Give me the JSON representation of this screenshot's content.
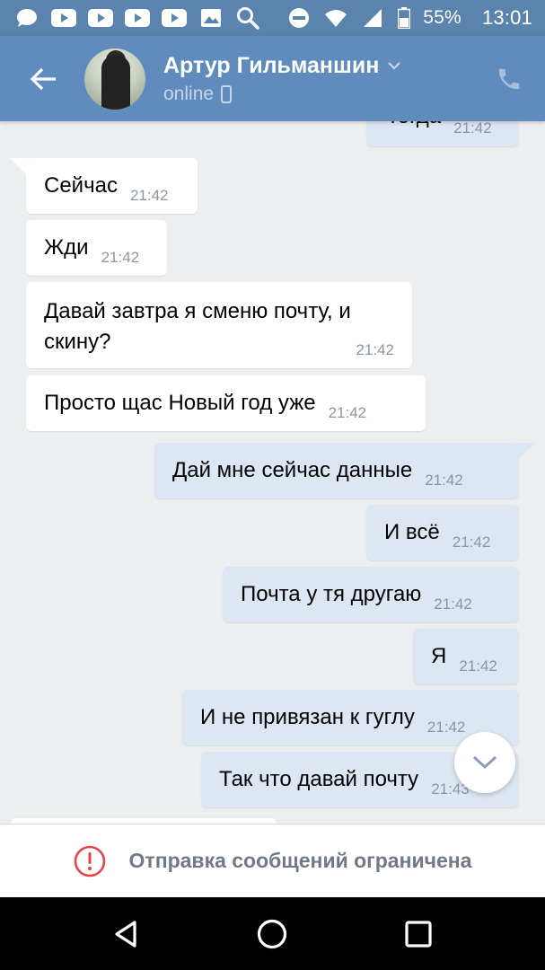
{
  "status_bar": {
    "battery": "55%",
    "time": "13:01",
    "left_icons": [
      "chat-bubble-icon",
      "youtube-icon",
      "youtube-icon",
      "youtube-icon",
      "youtube-icon",
      "image-icon",
      "search-icon"
    ],
    "right_icons": [
      "dnd-icon",
      "wifi-icon",
      "signal-icon",
      "battery-icon"
    ]
  },
  "header": {
    "name": "Артур Гильманшин",
    "status": "online",
    "colors": {
      "header": "#5f8bbd",
      "status_bar": "#5a83ad"
    }
  },
  "messages": [
    {
      "text": "тогда",
      "time": "21:42",
      "direction": "out"
    },
    {
      "text": "Сейчас",
      "time": "21:42",
      "direction": "in"
    },
    {
      "text": "Жди",
      "time": "21:42",
      "direction": "in"
    },
    {
      "text": "Давай завтра я сменю почту, и скину?",
      "time": "21:42",
      "direction": "in"
    },
    {
      "text": "Просто щас Новый год уже",
      "time": "21:42",
      "direction": "in"
    },
    {
      "text": "Дай мне сейчас данные",
      "time": "21:42",
      "direction": "out"
    },
    {
      "text": "И всё",
      "time": "21:42",
      "direction": "out"
    },
    {
      "text": "Почта у тя другаю",
      "time": "21:42",
      "direction": "out"
    },
    {
      "text": "Я",
      "time": "21:42",
      "direction": "out"
    },
    {
      "text": "И не привязан к гуглу",
      "time": "21:42",
      "direction": "out"
    },
    {
      "text": "Так что давай почту",
      "time": "21:43",
      "direction": "out"
    }
  ],
  "restriction": {
    "text": "Отправка сообщений ограничена"
  },
  "colors": {
    "incoming_bubble": "#ffffff",
    "outgoing_bubble": "#dce7f3",
    "chat_background": "#edeef0",
    "warning": "#e64646"
  }
}
